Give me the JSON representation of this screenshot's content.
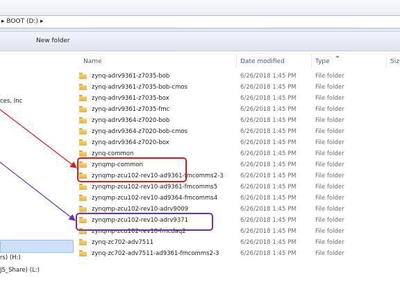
{
  "address": {
    "path": "BOOT (D:)",
    "separator_before": "▸",
    "separator_after": "▸"
  },
  "toolbar": {
    "new_folder_label": "New folder"
  },
  "nav": {
    "items": [
      "ces, Inc",
      "rs) (H:)",
      "JS_Share) (L:)"
    ]
  },
  "columns": {
    "name": "Name",
    "date": "Date modified",
    "type": "Type",
    "size": "Size"
  },
  "files": [
    {
      "name": "zynq-adrv9361-z7035-bob",
      "date": "6/26/2018 1:45 PM",
      "type": "File folder"
    },
    {
      "name": "zynq-adrv9361-z7035-bob-cmos",
      "date": "6/26/2018 1:45 PM",
      "type": "File folder"
    },
    {
      "name": "zynq-adrv9361-z7035-box",
      "date": "6/26/2018 1:45 PM",
      "type": "File folder"
    },
    {
      "name": "zynq-adrv9361-z7035-fmc",
      "date": "6/26/2018 1:45 PM",
      "type": "File folder"
    },
    {
      "name": "zynq-adrv9364-z7020-bob",
      "date": "6/26/2018 1:45 PM",
      "type": "File folder"
    },
    {
      "name": "zynq-adrv9364-z7020-bob-cmos",
      "date": "6/26/2018 1:45 PM",
      "type": "File folder"
    },
    {
      "name": "zynq-adrv9364-z7020-box",
      "date": "6/26/2018 1:45 PM",
      "type": "File folder"
    },
    {
      "name": "zynq-common",
      "date": "6/26/2018 1:45 PM",
      "type": "File folder"
    },
    {
      "name": "zynqmp-common",
      "date": "6/26/2018 1:45 PM",
      "type": "File folder"
    },
    {
      "name": "zynqmp-zcu102-rev10-ad9361-fmcomms2-3",
      "date": "6/26/2018 1:45 PM",
      "type": "File folder"
    },
    {
      "name": "zynqmp-zcu102-rev10-ad9361-fmcomms5",
      "date": "6/26/2018 1:45 PM",
      "type": "File folder"
    },
    {
      "name": "zynqmp-zcu102-rev10-ad9364-fmcomms4",
      "date": "6/26/2018 1:45 PM",
      "type": "File folder"
    },
    {
      "name": "zynqmp-zcu102-rev10-adrv9009",
      "date": "6/26/2018 1:45 PM",
      "type": "File folder"
    },
    {
      "name": "zynqmp-zcu102-rev10-adrv9371",
      "date": "6/26/2018 1:45 PM",
      "type": "File folder"
    },
    {
      "name": "zynqmp-zcu102-rev10-fmcdaq2",
      "date": "6/26/2018 1:45 PM",
      "type": "File folder"
    },
    {
      "name": "zynq-zc702-adv7511",
      "date": "6/26/2018 1:45 PM",
      "type": "File folder"
    },
    {
      "name": "zynq-zc702-adv7511-ad9361-fmcomms2-3",
      "date": "6/26/2018 1:45 PM",
      "type": "File folder"
    }
  ],
  "annotations": {
    "red_color": "#e01818",
    "purple_color": "#7030a0"
  },
  "icons": {
    "folder": "folder-icon",
    "sort": "sort-up-icon"
  }
}
